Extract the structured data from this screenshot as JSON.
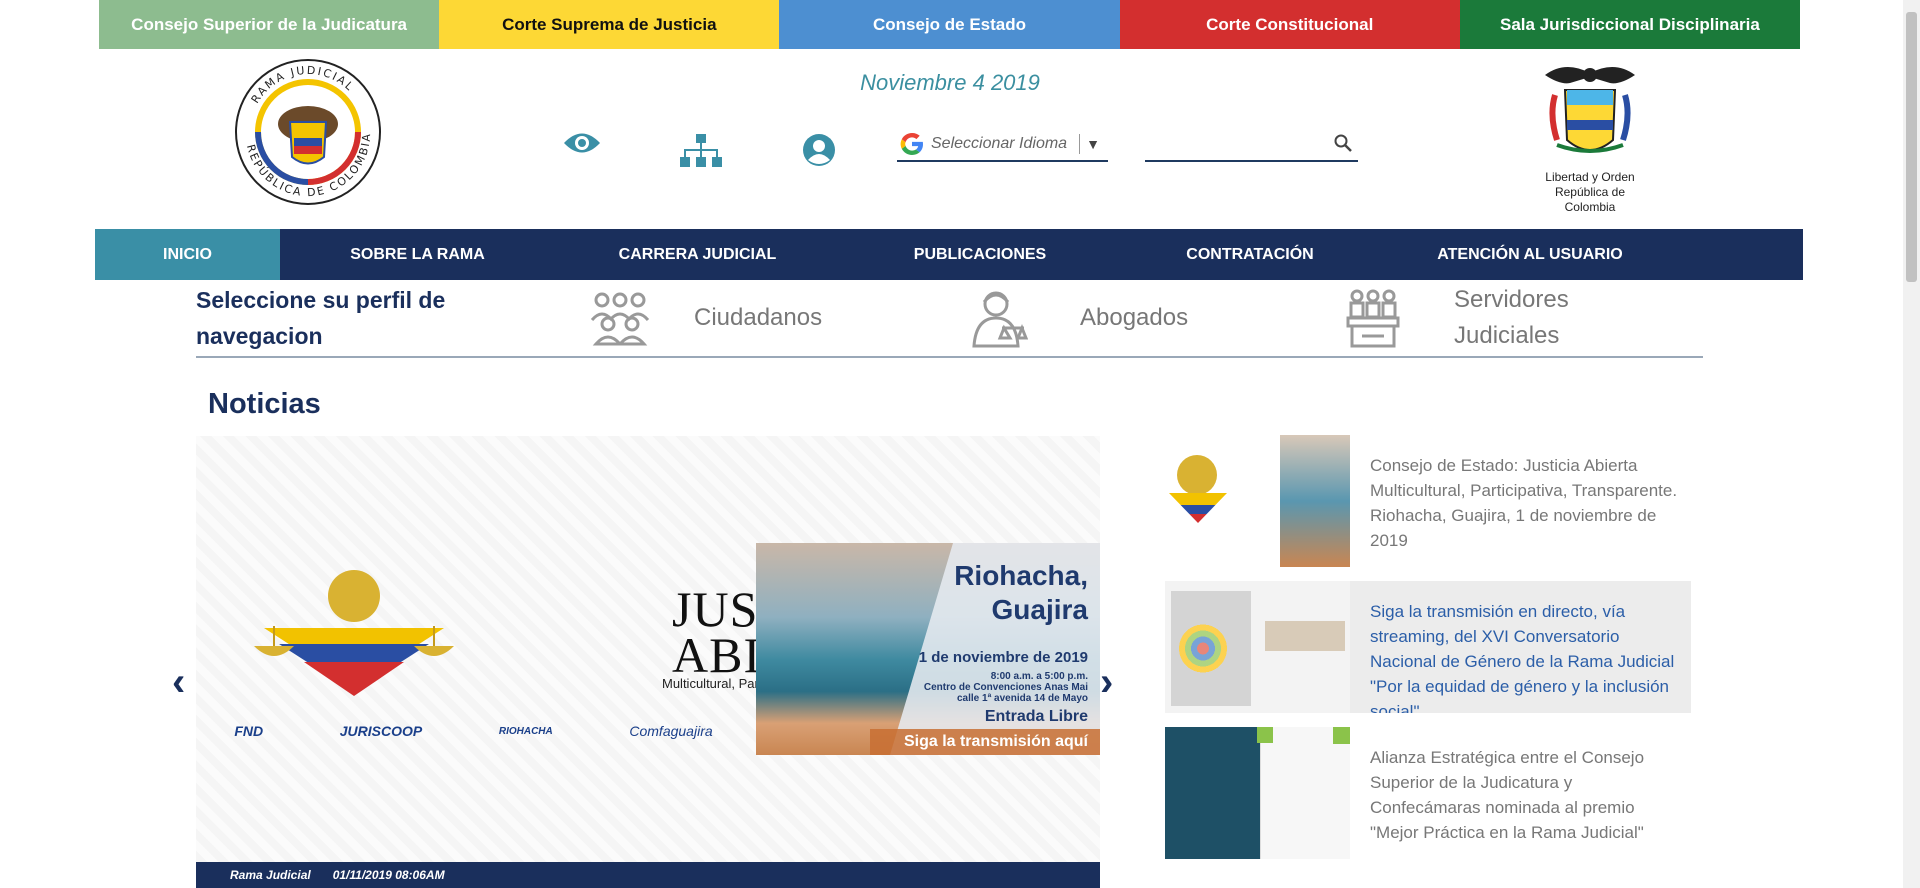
{
  "top_links": [
    {
      "label": "Consejo Superior de la Judicatura",
      "color": "#8dbc8f",
      "dark": false
    },
    {
      "label": "Corte Suprema de Justicia",
      "color": "#fdd835",
      "dark": true
    },
    {
      "label": "Consejo de Estado",
      "color": "#4d8fd1",
      "dark": false
    },
    {
      "label": "Corte Constitucional",
      "color": "#d32f2f",
      "dark": false
    },
    {
      "label": "Sala Jurisdiccional Disciplinaria",
      "color": "#1b7a3a",
      "dark": false
    }
  ],
  "header": {
    "date": "Noviembre 4 2019",
    "language_placeholder": "Seleccionar Idioma",
    "search_value": "",
    "right_logo_caption_1": "Libertad y Orden",
    "right_logo_caption_2": "República de Colombia",
    "left_logo_text_top": "RAMA JUDICIAL",
    "left_logo_text_bottom": "REPÚBLICA DE COLOMBIA"
  },
  "nav": [
    {
      "label": "INICIO",
      "active": true
    },
    {
      "label": "SOBRE LA RAMA",
      "active": false
    },
    {
      "label": "CARRERA JUDICIAL",
      "active": false
    },
    {
      "label": "PUBLICACIONES",
      "active": false
    },
    {
      "label": "CONTRATACIÓN",
      "active": false
    },
    {
      "label": "ATENCIÓN AL USUARIO",
      "active": false
    }
  ],
  "profile": {
    "title": "Seleccione su perfil de navegacion",
    "options": [
      {
        "label": "Ciudadanos",
        "icon": "people-group-icon"
      },
      {
        "label": "Abogados",
        "icon": "lawyer-icon"
      },
      {
        "label": "Servidores Judiciales",
        "icon": "judges-bench-icon"
      }
    ]
  },
  "news": {
    "heading": "Noticias",
    "slide": {
      "title_line1": "JUSTICIA",
      "title_line2": "ABIERTA",
      "subtitle": "Multicultural, Participativa y Transparente",
      "sponsors": [
        "FND",
        "JURISCOOP",
        "RIOHACHA",
        "Comfaguajira"
      ],
      "city_line1": "Riohacha,",
      "city_line2": "Guajira",
      "event_date": "1 de noviembre de 2019",
      "details_1": "8:00 a.m. a 5:00 p.m.",
      "details_2": "Centro de Convenciones Anas Mai",
      "details_3": "calle 1ª avenida 14 de Mayo",
      "entrada": "Entrada Libre",
      "cta": "Siga la transmisión aquí"
    },
    "caption_source": "Rama Judicial",
    "caption_date": "01/11/2019 08:06AM",
    "side_items": [
      {
        "text": "Consejo de Estado: Justicia Abierta Multicultural, Participativa, Transparente. Riohacha, Guajira, 1 de noviembre de 2019",
        "active": false
      },
      {
        "text": "Siga la transmisión en directo, vía streaming, del XVI Conversatorio Nacional de Género de la Rama Judicial \"Por la equidad de género y la inclusión social\"",
        "active": true
      },
      {
        "text": "Alianza Estratégica entre el Consejo Superior de la Judicatura y Confecámaras nominada al premio \"Mejor Práctica en la Rama Judicial\"",
        "active": false
      }
    ]
  }
}
